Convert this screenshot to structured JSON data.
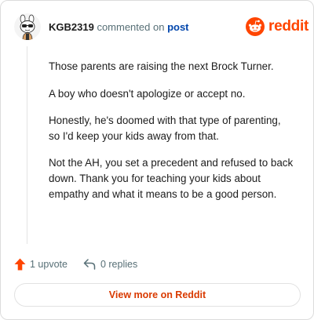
{
  "comment": {
    "username": "KGB2319",
    "action_text": "commented on",
    "post_link": "post",
    "paragraphs": [
      "Those parents are raising the next Brock Turner.",
      "A boy who doesn't apologize or accept no.",
      "Honestly, he's doomed with that type of parenting, so I'd keep your kids away from that.",
      "Not the AH, you set a precedent and refused to back down. Thank you for teaching your kids about empathy and what it means to be a good person."
    ],
    "upvotes": "1 upvote",
    "replies": "0 replies"
  },
  "brand": {
    "logo_text": "reddit",
    "accent_color": "#ff4500"
  },
  "footer": {
    "view_more": "View more on Reddit"
  },
  "icons": [
    "snoo-avatar-icon",
    "reddit-logo-icon",
    "upvote-arrow-icon",
    "reply-arrow-icon"
  ]
}
